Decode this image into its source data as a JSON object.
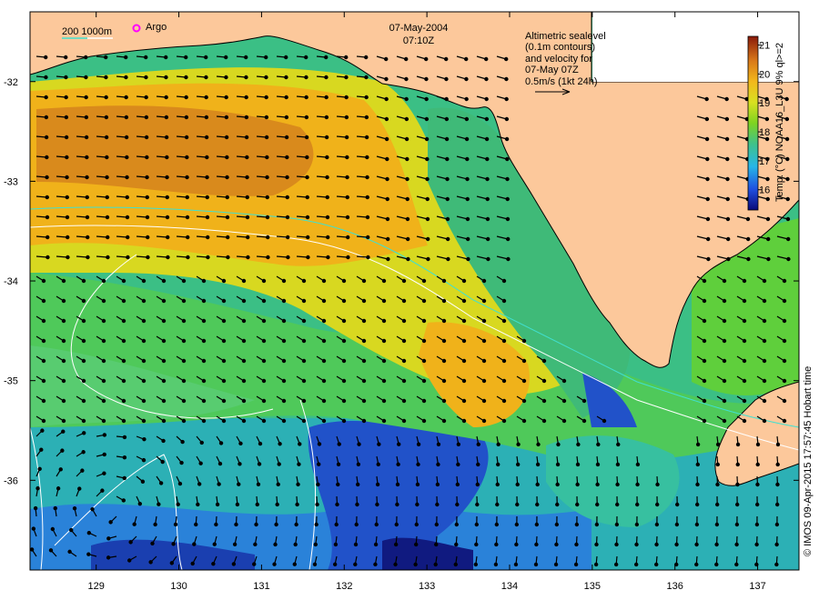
{
  "title": {
    "date": "07-May-2004",
    "time": "07:10Z"
  },
  "legend": {
    "isobaths": "200  1000m",
    "argo": "Argo"
  },
  "annotation": {
    "line1": "Altimetric sealevel",
    "line2": "(0.1m contours)",
    "line3": "and velocity for",
    "line4": "07-May 07Z",
    "line5": "0.5m/s (1kt 24h)"
  },
  "colorbar": {
    "label": "Temp. (°C) NOAA16_L3U 9% ql>=2",
    "ticks": [
      "21",
      "20",
      "19",
      "18",
      "17",
      "16"
    ],
    "min": 15.3,
    "max": 21.3
  },
  "credit": "© IMOS 09-Apr-2015 17:57:45 Hobart time",
  "axes": {
    "lon_ticks": [
      "129",
      "130",
      "131",
      "132",
      "133",
      "134",
      "135",
      "136",
      "137"
    ],
    "lat_ticks": [
      "-32",
      "-33",
      "-34",
      "-35",
      "-36"
    ],
    "lon_range": [
      128.2,
      137.5
    ],
    "lat_range": [
      -36.9,
      -31.3
    ]
  },
  "colors": {
    "land": "#fcc89b",
    "coastline": "#000000",
    "isobath_200": "#40e0d0",
    "isobath_1000": "#ffffff",
    "arrow": "#000000",
    "argo_marker": "#ff00ff"
  }
}
